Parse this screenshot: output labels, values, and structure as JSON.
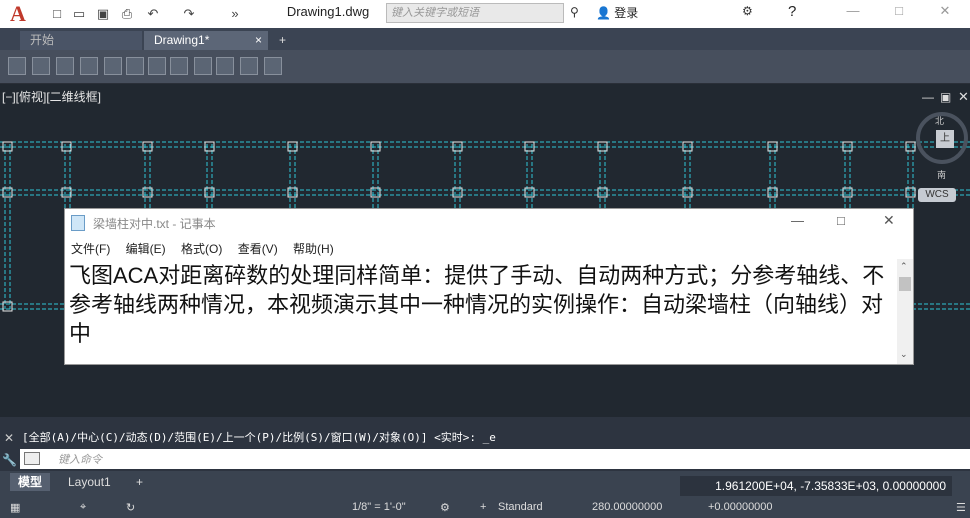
{
  "app": {
    "logo": "A",
    "document_title": "Drawing1.dwg",
    "search_placeholder": "键入关键字或短语",
    "login": "登录"
  },
  "tabs": [
    {
      "label": "开始"
    },
    {
      "label": "Drawing1*"
    }
  ],
  "viewport": {
    "label": "[−][俯视][二维线框]",
    "viewcube": {
      "north": "北",
      "south": "南",
      "face": "上"
    },
    "wcs": "WCS"
  },
  "notepad": {
    "title": "梁墙柱对中.txt - 记事本",
    "menu": [
      "文件(F)",
      "编辑(E)",
      "格式(O)",
      "查看(V)",
      "帮助(H)"
    ],
    "content": "飞图ACA对距离碎数的处理同样简单：提供了手动、自动两种方式；分参考轴线、不参考轴线两种情况，本视频演示其中一种情况的实例操作：自动梁墙柱（向轴线）对中"
  },
  "command": {
    "history": "[全部(A)/中心(C)/动态(D)/范围(E)/上一个(P)/比例(S)/窗口(W)/对象(O)] <实时>: _e",
    "placeholder": "键入命令"
  },
  "layouts": [
    {
      "label": "模型"
    },
    {
      "label": "Layout1"
    }
  ],
  "coords": "1.961200E+04, -7.35833E+03, 0.00000000",
  "status": {
    "scale": "1/8\" = 1'-0\"",
    "style": "Standard",
    "elevation": "280.00000000",
    "offset": "+0.00000000"
  }
}
